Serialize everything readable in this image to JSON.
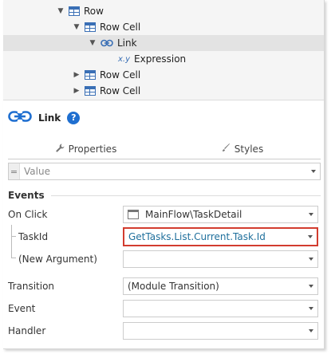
{
  "tree": {
    "items": [
      {
        "label": "Row",
        "icon": "table-icon",
        "expanded": true
      },
      {
        "label": "Row Cell",
        "icon": "table-icon",
        "expanded": true
      },
      {
        "label": "Link",
        "icon": "link-icon",
        "expanded": true,
        "selected": true
      },
      {
        "label": "Expression",
        "icon": "expression-icon",
        "icon_text": "x.y"
      },
      {
        "label": "Row Cell",
        "icon": "table-icon",
        "expanded": false
      },
      {
        "label": "Row Cell",
        "icon": "table-icon",
        "expanded": false
      }
    ]
  },
  "widget": {
    "title": "Link",
    "help": "?"
  },
  "tabs": [
    {
      "label": "Properties",
      "icon": "wrench-icon",
      "active": true
    },
    {
      "label": "Styles",
      "icon": "brush-icon",
      "active": false
    }
  ],
  "value_field": {
    "prefix": "=",
    "placeholder": "Value"
  },
  "events_section": "Events",
  "properties": {
    "on_click": {
      "label": "On Click",
      "value": "MainFlow\\TaskDetail"
    },
    "task_id": {
      "label": "TaskId",
      "value": "GetTasks.List.Current.Task.Id"
    },
    "new_argument": {
      "label": "(New Argument)",
      "value": ""
    },
    "transition": {
      "label": "Transition",
      "value": "(Module Transition)"
    },
    "event": {
      "label": "Event",
      "value": ""
    },
    "handler": {
      "label": "Handler",
      "value": ""
    }
  },
  "colors": {
    "accent": "#1f6fd0",
    "highlight_border": "#d23c2f",
    "expression_text": "#1f6f9c",
    "selected_row": "#e3e3e3"
  }
}
